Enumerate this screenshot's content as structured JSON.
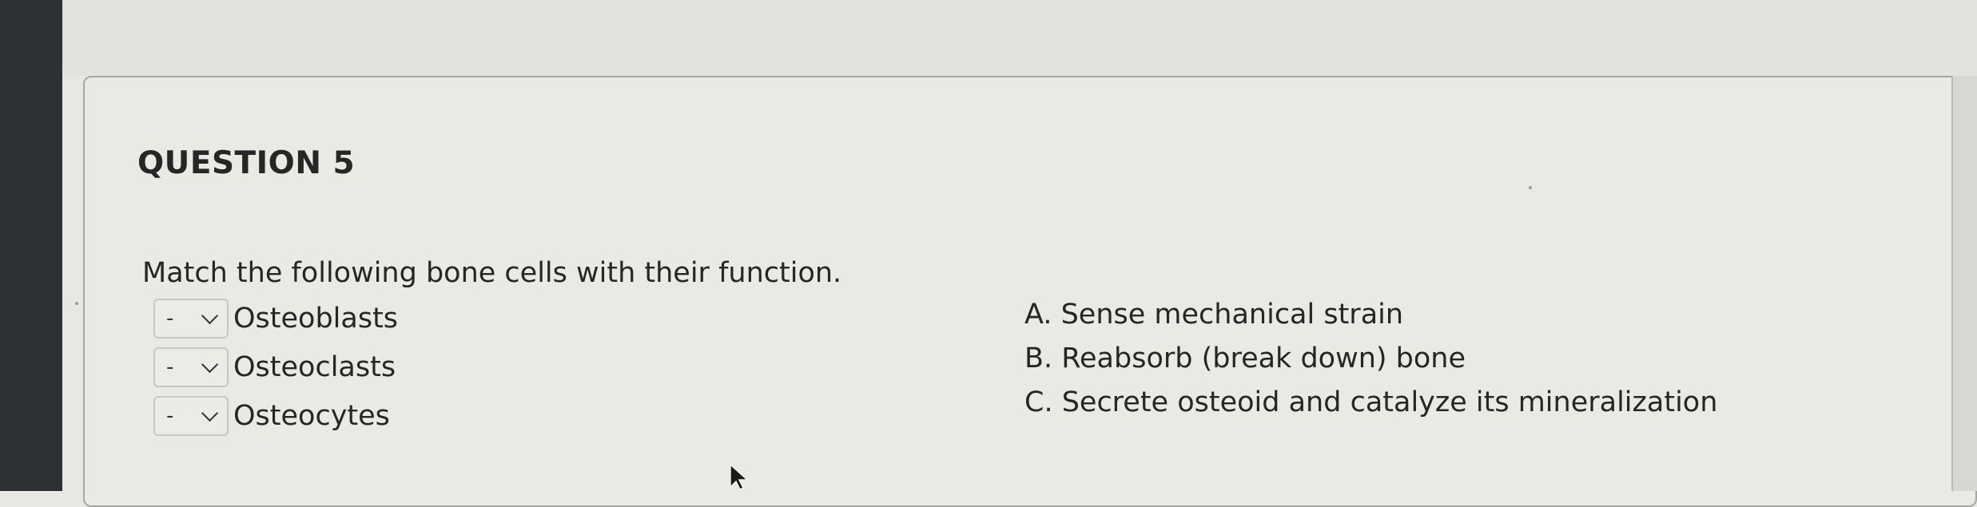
{
  "question": {
    "title": "QUESTION 5",
    "prompt": "Match the following bone cells with their function."
  },
  "matches": [
    {
      "selected": "-",
      "term": "Osteoblasts"
    },
    {
      "selected": "-",
      "term": "Osteoclasts"
    },
    {
      "selected": "-",
      "term": "Osteocytes"
    }
  ],
  "answers": [
    "A. Sense mechanical strain",
    "B. Reabsorb (break down) bone",
    "C. Secrete osteoid and catalyze its mineralization"
  ]
}
